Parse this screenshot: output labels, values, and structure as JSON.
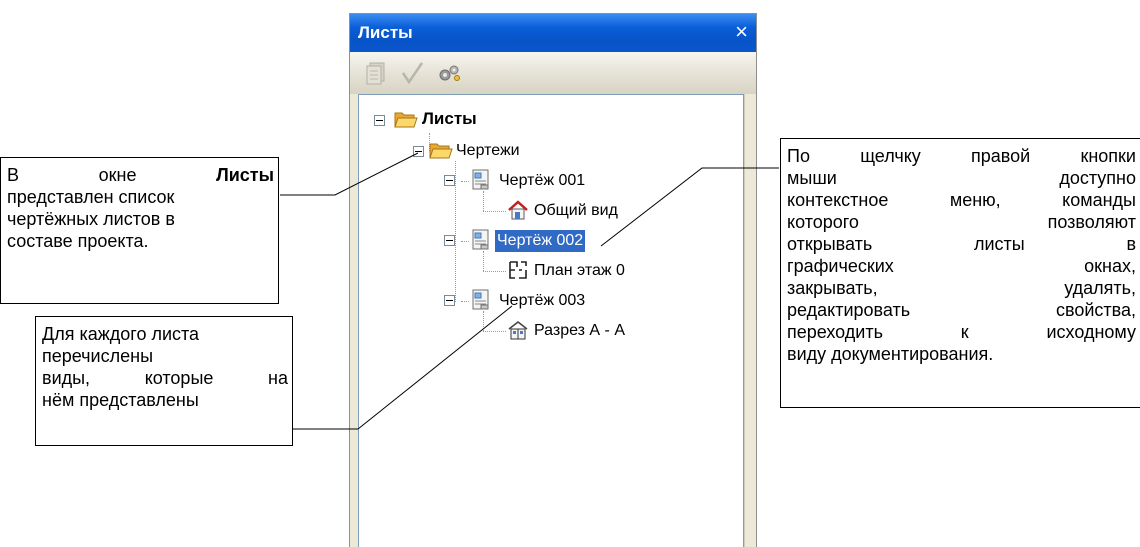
{
  "window": {
    "title": "Листы",
    "close_glyph": "×",
    "toolbar": {
      "buttons": [
        {
          "name": "sheets-icon",
          "enabled": false
        },
        {
          "name": "checkmark-icon",
          "enabled": false
        },
        {
          "name": "properties-icon",
          "enabled": true
        }
      ]
    },
    "tree": {
      "root": "Листы",
      "group": "Чертежи",
      "sheets": [
        {
          "label": "Чертёж 001",
          "view": "Общий вид",
          "view_icon": "house-view-icon"
        },
        {
          "label": "Чертёж 002",
          "view": "План этаж 0",
          "view_icon": "floor-plan-icon",
          "selected": true
        },
        {
          "label": "Чертёж 003",
          "view": "Разрез А - А",
          "view_icon": "section-view-icon"
        }
      ]
    }
  },
  "callouts": {
    "left_top": {
      "line1_word1": "В",
      "line1_word2": "окне",
      "line1_bold": "Листы",
      "line2": "представлен список",
      "line3": "чертёжных листов в",
      "line4": "составе проекта."
    },
    "left_bottom": {
      "line1": "Для каждого листа",
      "line2": "перечислены",
      "line3": "виды, которые на",
      "line4": "нём представлены"
    },
    "right": {
      "lines": [
        "По щелчку правой кнопки",
        "мыши доступно",
        "контекстное меню, команды",
        "которого позволяют",
        "открывать листы в",
        "графических окнах,",
        "закрывать, удалять,",
        "редактировать свойства,",
        "переходить к исходному",
        "виду документирования."
      ]
    }
  },
  "colors": {
    "title_bar": "#0a5fd9",
    "selection": "#316ac5",
    "panel": "#ece9d8",
    "folder": "#f5c24a"
  }
}
